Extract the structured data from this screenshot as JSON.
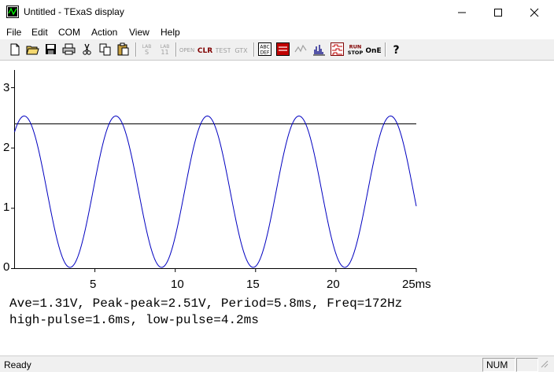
{
  "window": {
    "title": "Untitled - TExaS display",
    "minimize_glyph": "—",
    "maximize_glyph": "☐",
    "close_glyph": "✕"
  },
  "menu": [
    "File",
    "Edit",
    "COM",
    "Action",
    "View",
    "Help"
  ],
  "toolbar": {
    "buttons": [
      {
        "icon": "new-file-icon"
      },
      {
        "icon": "open-folder-icon"
      },
      {
        "icon": "save-icon"
      },
      {
        "icon": "print-icon"
      },
      {
        "icon": "cut-icon"
      },
      {
        "icon": "copy-icon"
      },
      {
        "icon": "paste-icon"
      },
      {
        "icon": "lab-s-icon",
        "text": "LAB\nS",
        "enabled": false
      },
      {
        "icon": "lab-11-icon",
        "text": "LAB\n11",
        "enabled": false
      },
      {
        "icon": "open-icon",
        "text": "OPEN",
        "enabled": false
      },
      {
        "icon": "clr-icon",
        "text": "CLR",
        "enabled": true
      },
      {
        "icon": "test-icon",
        "text": "TEST",
        "enabled": false
      },
      {
        "icon": "gtx-icon",
        "text": "GTX",
        "enabled": false
      },
      {
        "icon": "abc-def-icon",
        "text": "ABC\nDEF",
        "enabled": true
      },
      {
        "icon": "stop-icon",
        "enabled": true
      },
      {
        "icon": "scope-icon",
        "enabled": false
      },
      {
        "icon": "bar-graph-icon",
        "enabled": true
      },
      {
        "icon": "logic-analyzer-icon",
        "enabled": true
      },
      {
        "icon": "run-stop-icon",
        "text": "RUN\nSTOP",
        "enabled": true
      },
      {
        "icon": "one-icon",
        "text": "ONE",
        "enabled": true
      },
      {
        "icon": "help-icon",
        "text": "?",
        "enabled": true
      }
    ]
  },
  "chart_data": {
    "type": "line",
    "ylim": [
      0,
      3.3
    ],
    "xlim": [
      0,
      25
    ],
    "x_unit": "ms",
    "yticks": [
      "0",
      "1",
      "2",
      "3"
    ],
    "xticks": [
      "5",
      "10",
      "15",
      "20",
      "25ms"
    ],
    "xtick_values": [
      5,
      10,
      15,
      20,
      25
    ],
    "ytick_values": [
      0,
      1,
      2,
      3
    ],
    "reference_line": {
      "y": 2.4,
      "x_from": 0,
      "x_to": 25
    },
    "series": [
      {
        "color": "#0000c0",
        "period_ms": 5.7,
        "min": 0.02,
        "max": 2.53,
        "first_peak_ms": 0.6,
        "x_end_ms": 25
      }
    ],
    "line_color_ref": "#000000"
  },
  "stats": {
    "line1": "Ave=1.31V, Peak-peak=2.51V, Period=5.8ms, Freq=172Hz",
    "line2": "high-pulse=1.6ms, low-pulse=4.2ms"
  },
  "status": {
    "text": "Ready",
    "num": "NUM"
  }
}
